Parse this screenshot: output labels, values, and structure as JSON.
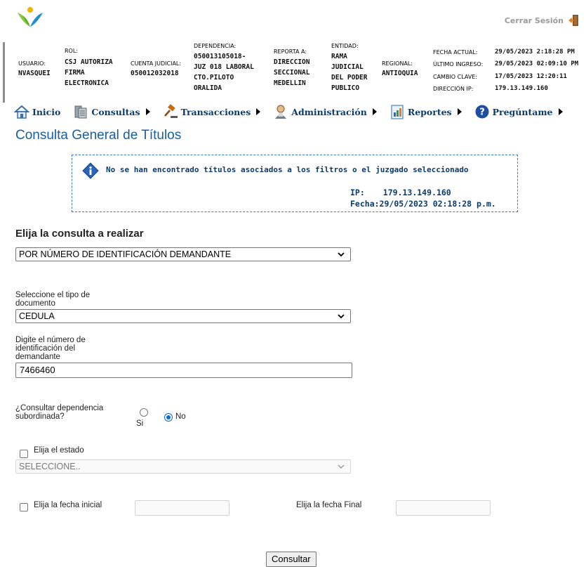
{
  "header": {
    "logout_label": "Cerrar Sesión",
    "usuario": {
      "label": "USUARIO:",
      "value": "NVASQUEI"
    },
    "rol": {
      "label": "ROL:",
      "lines": [
        "CSJ AUTORIZA",
        "FIRMA",
        "ELECTRONICA"
      ]
    },
    "cuenta": {
      "label": "CUENTA JUDICIAL:",
      "value": "050012032018"
    },
    "dependencia": {
      "label": "DEPENDENCIA:",
      "lines": [
        "050013105018-",
        "JUZ 018 LABORAL",
        "CTO.PILOTO",
        "ORALIDA"
      ]
    },
    "reporta": {
      "label": "REPORTA A:",
      "lines": [
        "DIRECCION",
        "SECCIONAL",
        "MEDELLIN"
      ]
    },
    "entidad": {
      "label": "ENTIDAD:",
      "lines": [
        "RAMA",
        "JUDICIAL",
        "DEL PODER",
        "PUBLICO"
      ]
    },
    "regional": {
      "label": "REGIONAL:",
      "value": "ANTIOQUIA"
    },
    "fecha_actual": {
      "label": "FECHA ACTUAL:",
      "value": "29/05/2023 2:18:28 PM"
    },
    "ultimo_ingreso": {
      "label": "ÚLTIMO INGRESO:",
      "value": "29/05/2023 02:09:10 PM"
    },
    "cambio_clave": {
      "label": "CAMBIO CLAVE:",
      "value": "17/05/2023 12:20:11"
    },
    "direccion_ip": {
      "label": "DIRECCIÓN IP:",
      "value": "179.13.149.160"
    }
  },
  "menu": [
    {
      "label": "Inicio",
      "icon": "home-icon"
    },
    {
      "label": "Consultas",
      "icon": "server-icon"
    },
    {
      "label": "Transacciones",
      "icon": "gavel-icon"
    },
    {
      "label": "Administración",
      "icon": "admin-user-icon"
    },
    {
      "label": "Reportes",
      "icon": "report-icon"
    },
    {
      "label": "Pregúntame",
      "icon": "help-icon"
    }
  ],
  "page_title": "Consulta General de Títulos",
  "message": {
    "text": "No se han encontrado títulos asociados a los filtros o el juzgado seleccionado",
    "ip_label": "IP:",
    "ip_value": "179.13.149.160",
    "fecha_label": "Fecha:",
    "fecha_value": "29/05/2023 02:18:28 p.m."
  },
  "form": {
    "section_title": "Elija la consulta a realizar",
    "consulta_selected": "POR NÚMERO DE IDENTIFICACIÓN DEMANDANTE",
    "tipo_doc_label_1": "Seleccione el tipo de",
    "tipo_doc_label_2": "documento",
    "tipo_doc_selected": "CEDULA",
    "num_label_1": "Digite el número de",
    "num_label_2": "identificación del",
    "num_label_3": "demandante",
    "num_value": "7466460",
    "sub_label_1": "¿Consultar dependencia",
    "sub_label_2": "subordinada?",
    "radio_si": "Si",
    "radio_no": "No",
    "estado_label": "Elija el estado",
    "estado_selected": "SELECCIONE..",
    "fecha_inicial_label": "Elija la fecha inicial",
    "fecha_final_label": "Elija la fecha Final",
    "submit_label": "Consultar"
  },
  "colors": {
    "accent": "#1a5da0",
    "nav_text": "#0b3a6b",
    "radio": "#0b6bd6"
  }
}
